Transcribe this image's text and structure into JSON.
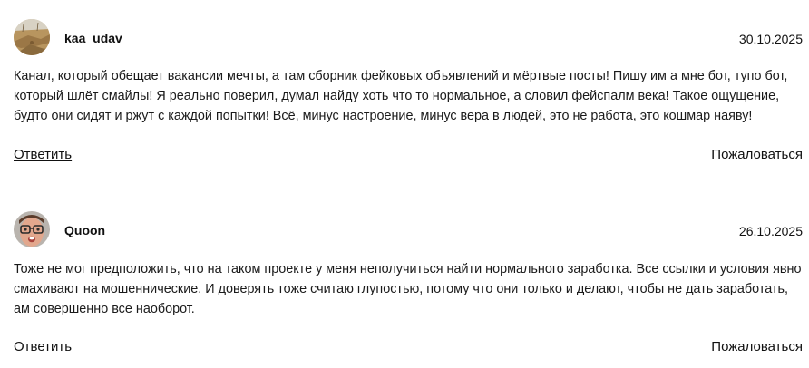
{
  "comments": [
    {
      "username": "kaa_udav",
      "date": "30.10.2025",
      "text": "Канал, который обещает вакансии мечты, а там сборник фейковых объявлений и мёртвые посты! Пишу им а мне бот, тупо бот, который шлёт смайлы! Я реально поверил, думал найду хоть что то нормальное, а словил фейспалм века! Такое ощущение, будто они сидят и ржут с каждой попытки! Всё, минус настроение, минус вера в людей, это не работа, это кошмар наяву!",
      "reply_label": "Ответить",
      "report_label": "Пожаловаться",
      "avatar_icon": "landscape-photo-avatar"
    },
    {
      "username": "Quoon",
      "date": "26.10.2025",
      "text": "Тоже не мог предположить, что на таком проекте у меня неполучиться найти нормального заработка. Все ссылки и условия явно смахивают на мошеннические. И доверять тоже считаю глупостью, потому что они только и делают, чтобы не дать заработать, ам совершенно все наоборот.",
      "reply_label": "Ответить",
      "report_label": "Пожаловаться",
      "avatar_icon": "glasses-face-avatar"
    }
  ],
  "colors": {
    "text": "#1a1a1a",
    "divider": "#e3e3e3",
    "background": "#ffffff"
  }
}
